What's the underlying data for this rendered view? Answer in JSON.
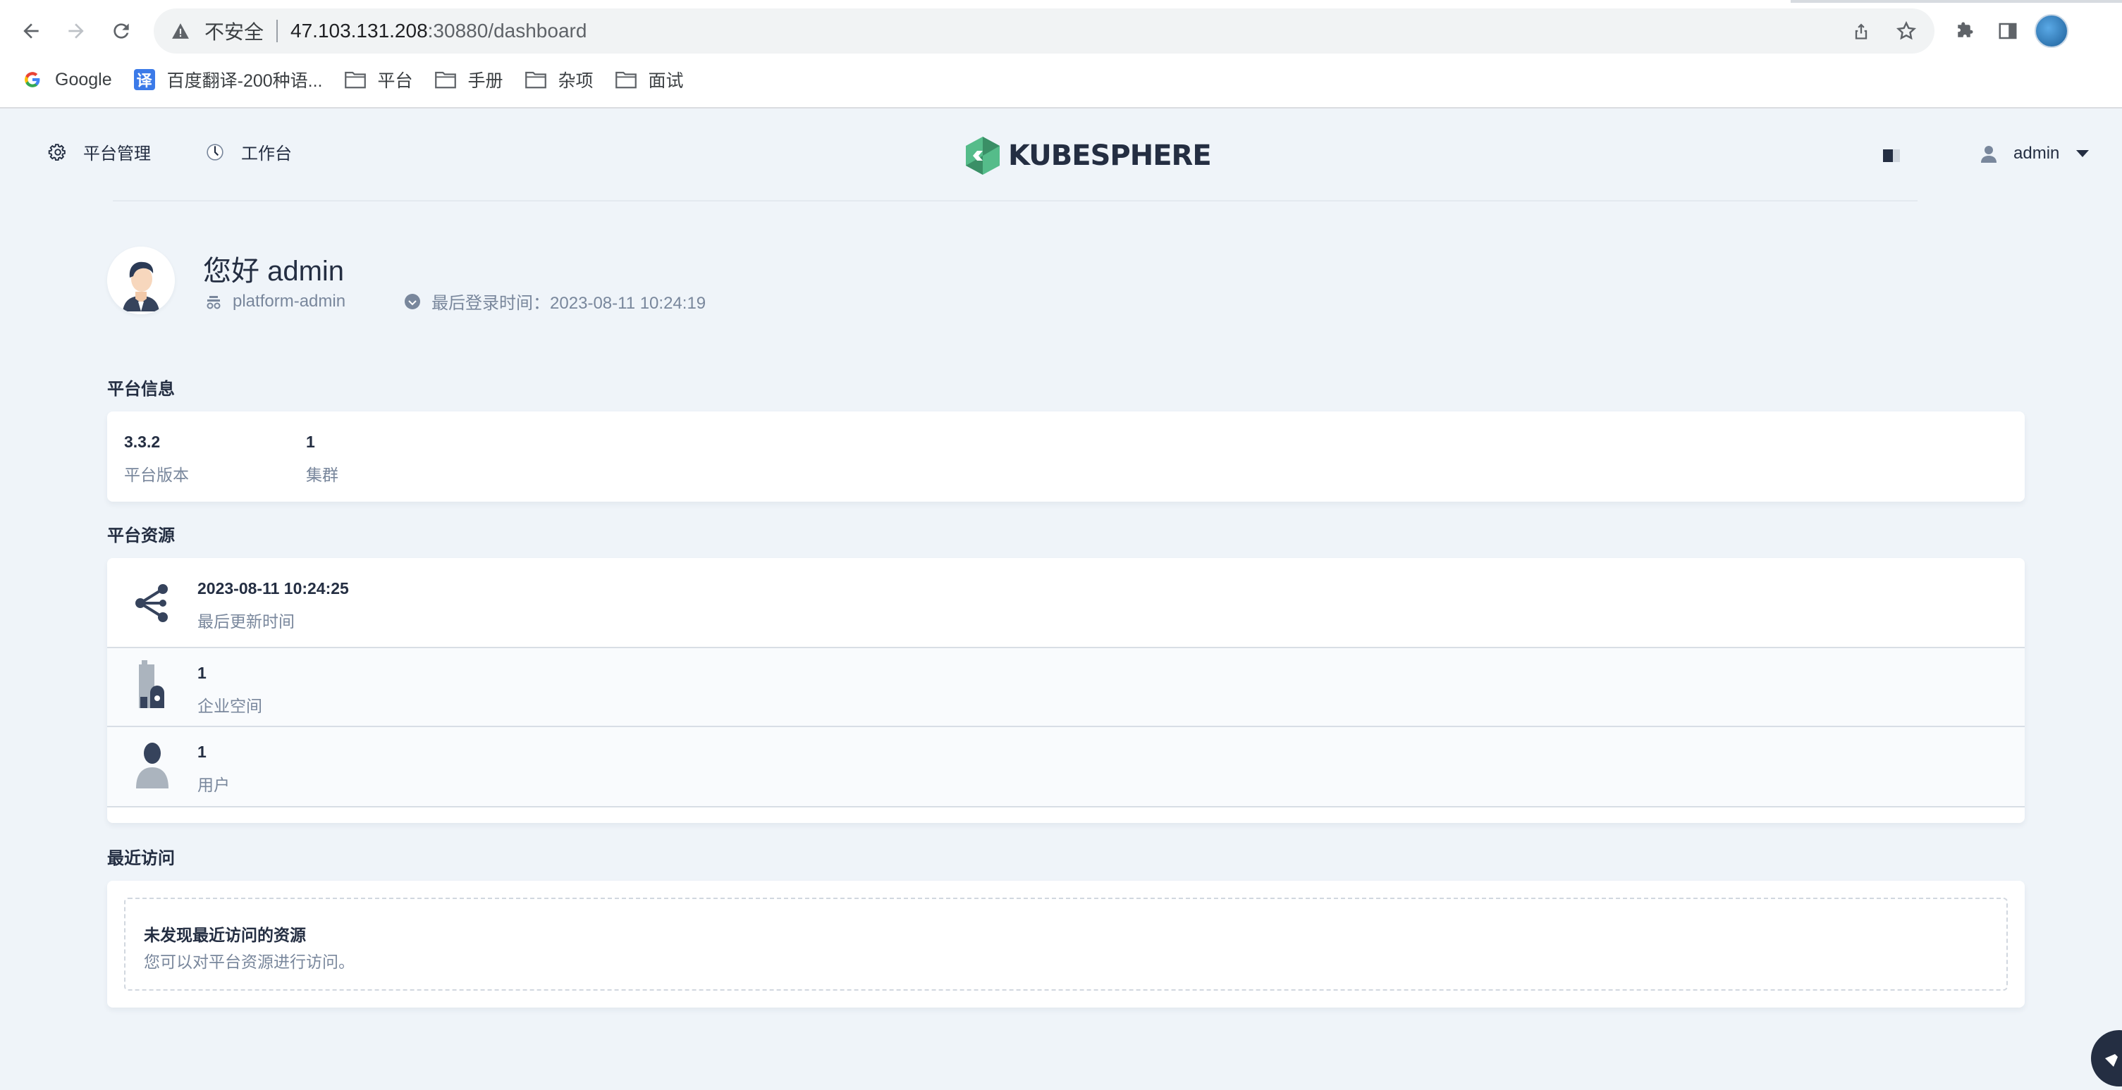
{
  "browser": {
    "security_label": "不安全",
    "url_host": "47.103.131.208",
    "url_rest": ":30880/dashboard",
    "bookmarks": [
      {
        "label": "Google",
        "icon": "google-icon"
      },
      {
        "label": "百度翻译-200种语...",
        "icon": "translate-icon"
      },
      {
        "label": "平台",
        "icon": "folder-icon"
      },
      {
        "label": "手册",
        "icon": "folder-icon"
      },
      {
        "label": "杂项",
        "icon": "folder-icon"
      },
      {
        "label": "面试",
        "icon": "folder-icon"
      }
    ]
  },
  "header": {
    "platform_label": "平台管理",
    "workbench_label": "工作台",
    "logo_text": "KUBESPHERE",
    "user_name": "admin",
    "accent_color": "#55bc8a"
  },
  "greeting": {
    "title": "您好 admin",
    "role": "platform-admin",
    "last_login": "最后登录时间：2023-08-11 10:24:19"
  },
  "platform_info": {
    "title": "平台信息",
    "items": [
      {
        "value": "3.3.2",
        "label": "平台版本"
      },
      {
        "value": "1",
        "label": "集群"
      }
    ]
  },
  "platform_resources": {
    "title": "平台资源",
    "items": [
      {
        "value": "2023-08-11 10:24:25",
        "label": "最后更新时间",
        "icon": "share-nodes-icon"
      },
      {
        "value": "1",
        "label": "企业空间",
        "icon": "workspace-icon"
      },
      {
        "value": "1",
        "label": "用户",
        "icon": "user-icon"
      }
    ]
  },
  "recent": {
    "title": "最近访问",
    "empty_title": "未发现最近访问的资源",
    "empty_desc": "您可以对平台资源进行访问。"
  }
}
